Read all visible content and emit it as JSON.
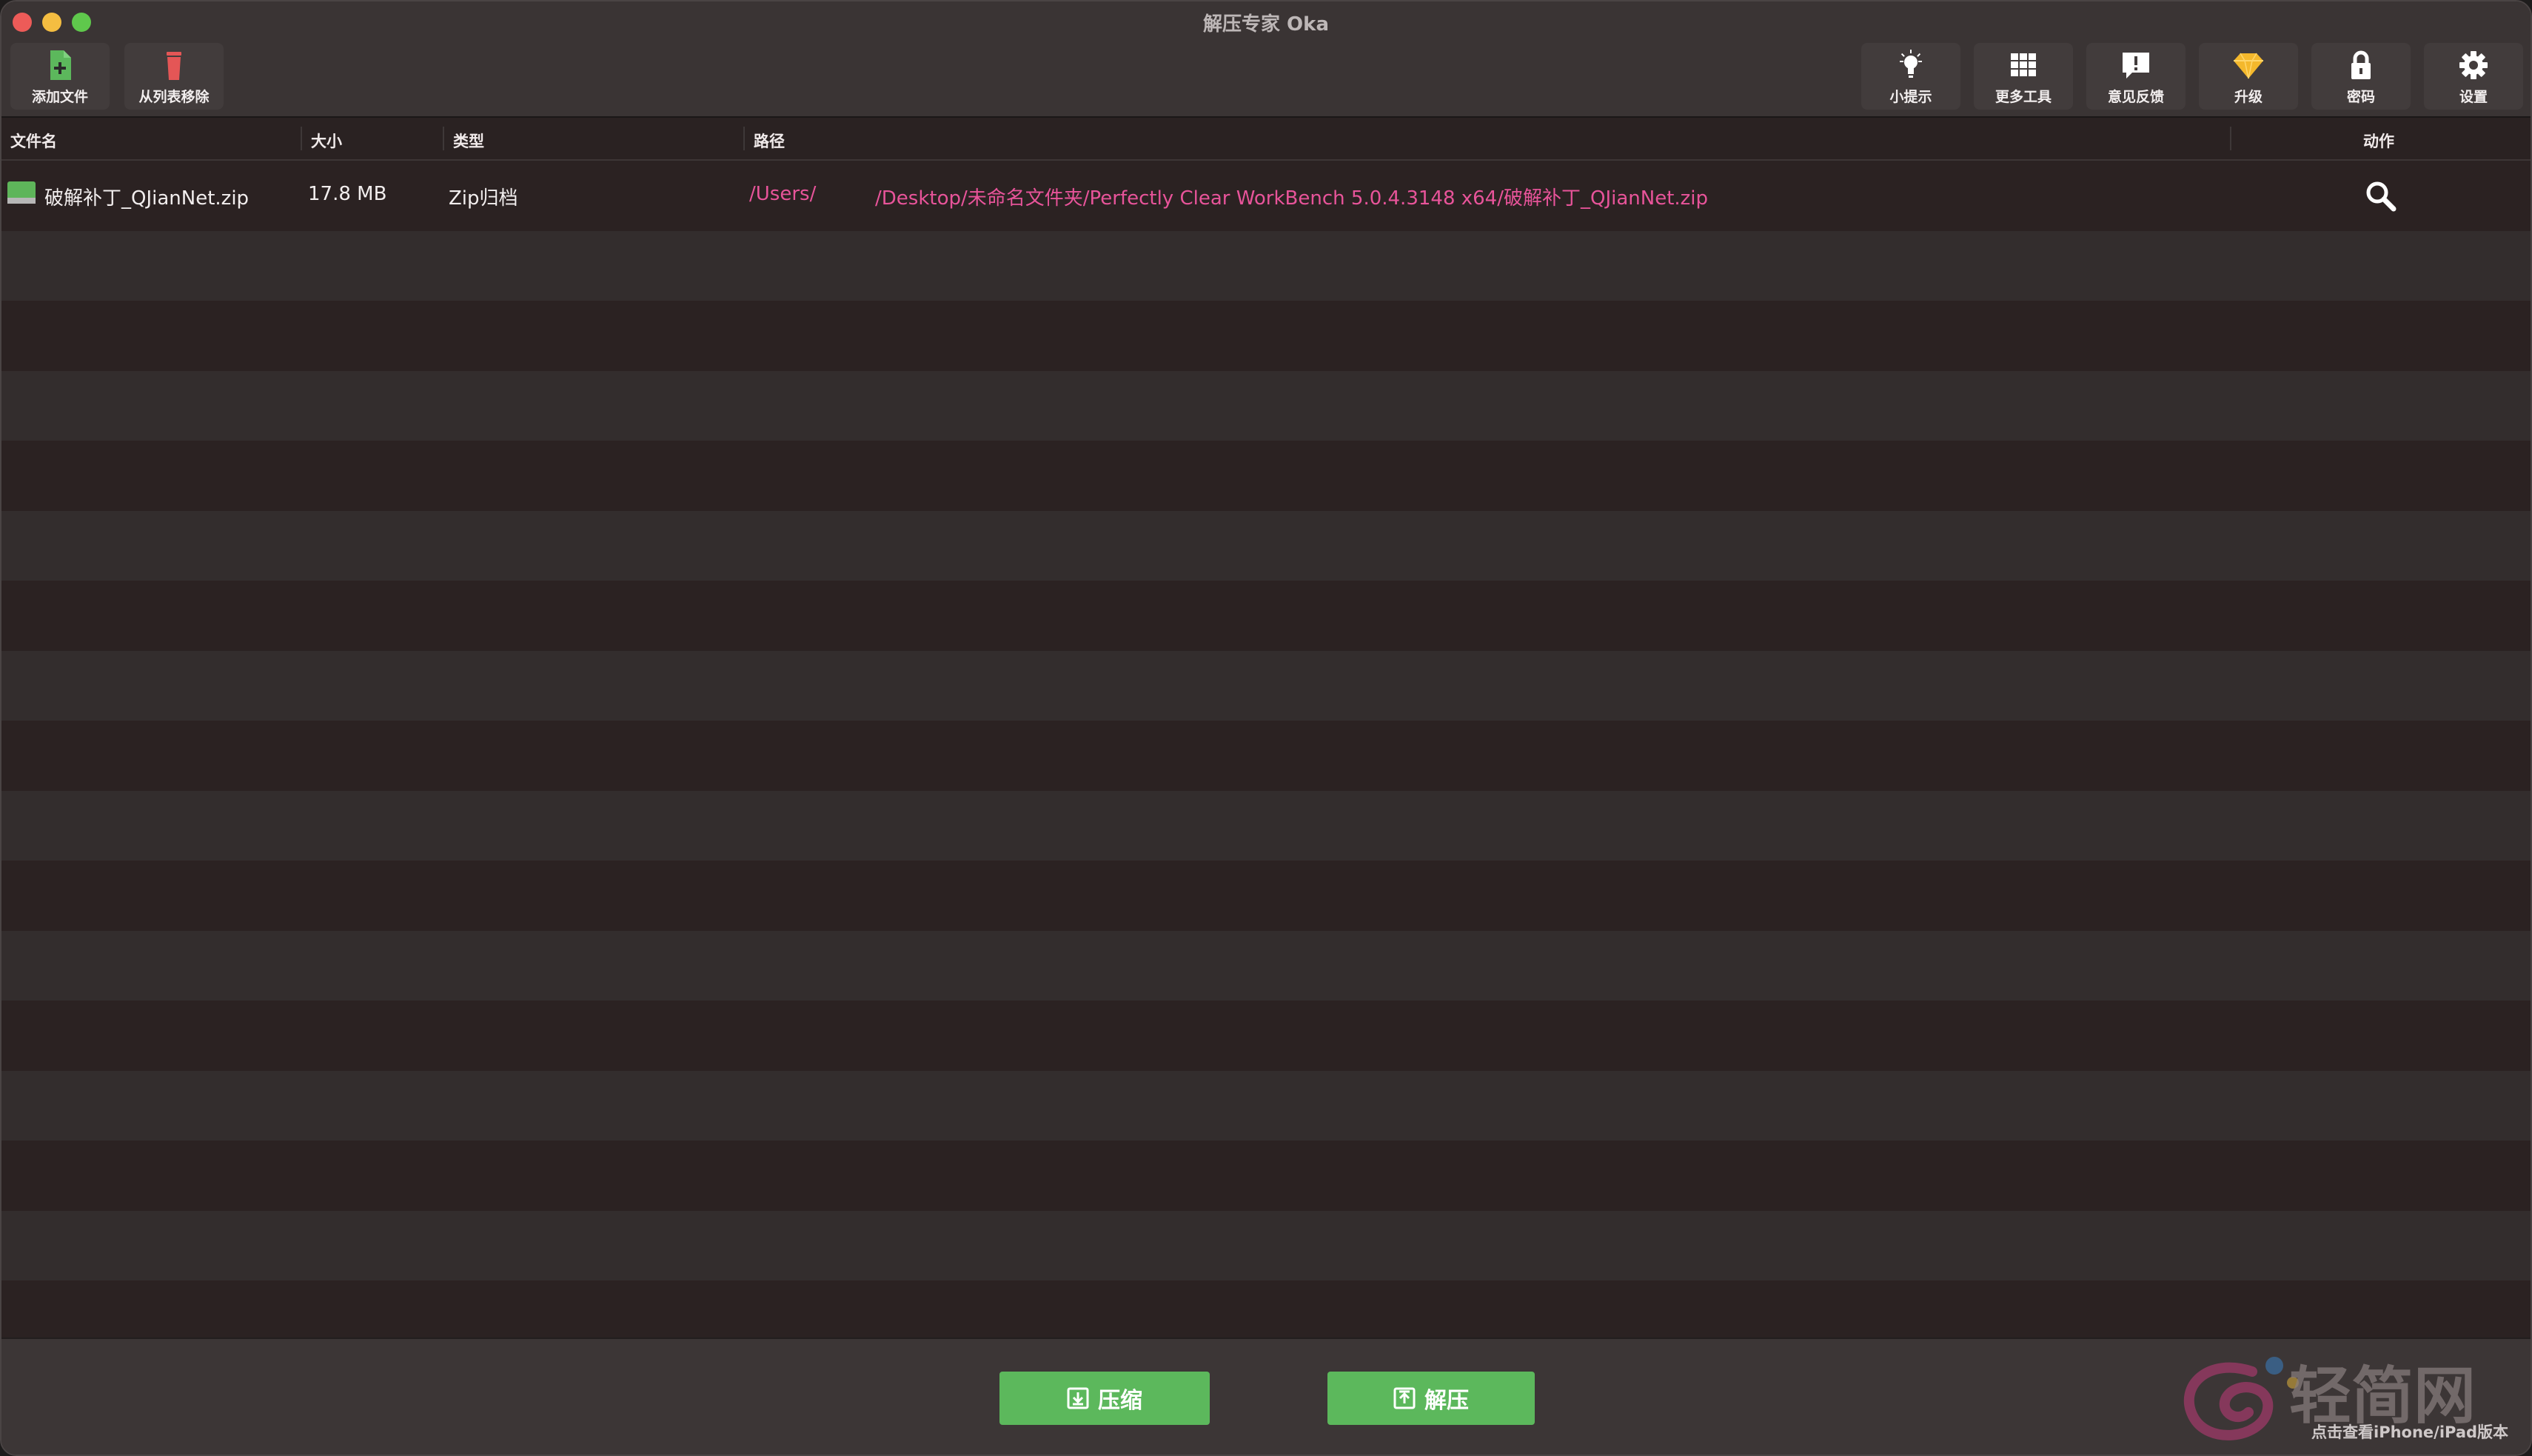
{
  "window": {
    "title": "解压专家 Oka"
  },
  "toolbar": {
    "left": [
      {
        "label": "添加文件",
        "icon": "add-file-icon"
      },
      {
        "label": "从列表移除",
        "icon": "trash-icon"
      }
    ],
    "right": [
      {
        "label": "小提示",
        "icon": "lightbulb-icon"
      },
      {
        "label": "更多工具",
        "icon": "grid-icon"
      },
      {
        "label": "意见反馈",
        "icon": "feedback-icon"
      },
      {
        "label": "升级",
        "icon": "diamond-icon"
      },
      {
        "label": "密码",
        "icon": "lock-icon"
      },
      {
        "label": "设置",
        "icon": "gear-icon"
      }
    ]
  },
  "table": {
    "columns": {
      "name": "文件名",
      "size": "大小",
      "type": "类型",
      "path": "路径",
      "action": "动作"
    },
    "rows": [
      {
        "name": "破解补丁_QJianNet.zip",
        "size": "17.8 MB",
        "type": "Zip归档",
        "path_start": "/Users/",
        "path_end": "/Desktop/未命名文件夹/Perfectly Clear WorkBench 5.0.4.3148 x64/破解补丁_QJianNet.zip",
        "action_icon": "search-icon"
      }
    ]
  },
  "bottom": {
    "compress_label": "压缩",
    "extract_label": "解压"
  },
  "watermark": {
    "brand": "轻简网",
    "note": "点击查看iPhone/iPad版本"
  },
  "colors": {
    "accent_green": "#5cb85c",
    "path_pink": "#e8549a",
    "delete_red": "#e45656"
  }
}
